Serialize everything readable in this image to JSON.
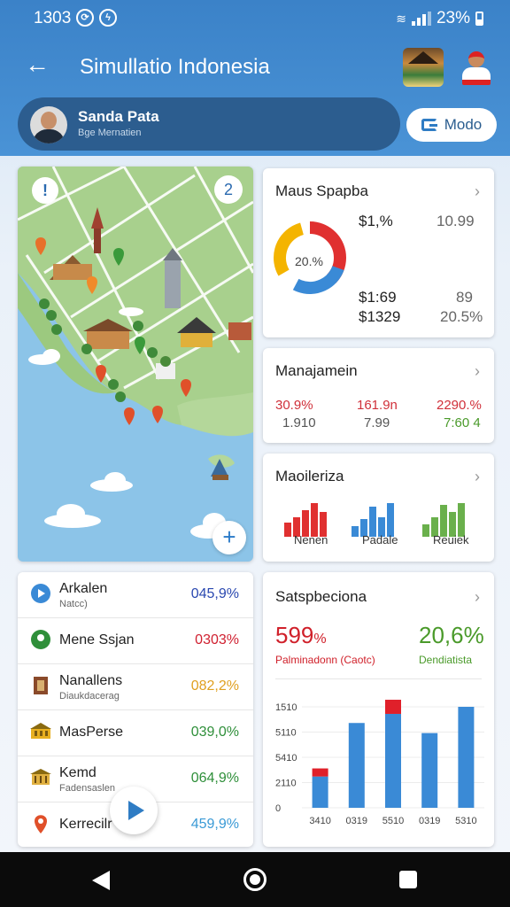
{
  "status_bar": {
    "time": "1303",
    "battery": "23%"
  },
  "app_bar": {
    "title": "Simullatio Indonesia"
  },
  "user": {
    "name": "Sanda Pata",
    "subtitle": "Bge Mernatien"
  },
  "mode_button": {
    "label": "Modo"
  },
  "map": {
    "info_icon": "!",
    "count": "2",
    "zoom_icon": "+"
  },
  "card_spending": {
    "title": "Maus Spapba",
    "donut_center": "20.%",
    "v1": "$1,%",
    "v2": "10.99",
    "v3": "$1:69",
    "v4": "89",
    "v5": "$1329",
    "v6": "20.5%"
  },
  "card_management": {
    "title": "Manajamein",
    "c1_top": "30.9%",
    "c1_bot": "1.910",
    "c2_top": "161.9n",
    "c2_bot": "7.99",
    "c3_top": "2290.%",
    "c3_bot": "7:60 4"
  },
  "card_mobilization": {
    "title": "Maoileriza",
    "groups": [
      {
        "label": "Nenen",
        "color": "#e03030",
        "values": [
          0.4,
          0.55,
          0.75,
          0.95,
          0.7
        ]
      },
      {
        "label": "Padale",
        "color": "#3a8ad6",
        "values": [
          0.3,
          0.5,
          0.85,
          0.55,
          0.95
        ]
      },
      {
        "label": "Reuiek",
        "color": "#6ab04c",
        "values": [
          0.35,
          0.55,
          0.9,
          0.7,
          0.95
        ]
      }
    ]
  },
  "list": [
    {
      "name": "Arkalen",
      "sub": "Natcc)",
      "pct": "045,9%",
      "color": "#2a48b0",
      "icon": "play-circle-icon"
    },
    {
      "name": "Mene Ssjan",
      "sub": "",
      "pct": "0303%",
      "color": "#d02030",
      "icon": "map-pin-icon"
    },
    {
      "name": "Nanallens",
      "sub": "Diaukdacerag",
      "pct": "082,2%",
      "color": "#e0a020",
      "icon": "building-icon"
    },
    {
      "name": "MasPerse",
      "sub": "",
      "pct": "039,0%",
      "color": "#2f8f3a",
      "icon": "temple-icon"
    },
    {
      "name": "Kemd",
      "sub": "Fadensaslen",
      "pct": "064,9%",
      "color": "#2f8f3a",
      "icon": "museum-icon"
    },
    {
      "name": "Kerrecilr",
      "sub": "",
      "pct": "459,9%",
      "color": "#3a9ad6",
      "icon": "location-icon"
    }
  ],
  "card_stats": {
    "title": "Satspbeciona",
    "left_value": "599",
    "left_unit": "%",
    "left_caption": "Palminadonn (Caotc)",
    "right_value": "20,6%",
    "right_caption": "Dendiatista",
    "accent_red": "#d0202a",
    "accent_green": "#4a9a2a"
  },
  "chart_data": {
    "type": "bar",
    "categories": [
      "3410",
      "0319",
      "5510",
      "0319",
      "5310"
    ],
    "y_ticks": [
      "1510",
      "5110",
      "5410",
      "2110",
      "0"
    ],
    "ylim": [
      0,
      1
    ],
    "series": [
      {
        "values": [
          0.31,
          0.84,
          0.93,
          0.74,
          1.0
        ]
      },
      {
        "values": [
          0.08,
          0,
          0.14,
          0,
          0
        ]
      }
    ]
  }
}
